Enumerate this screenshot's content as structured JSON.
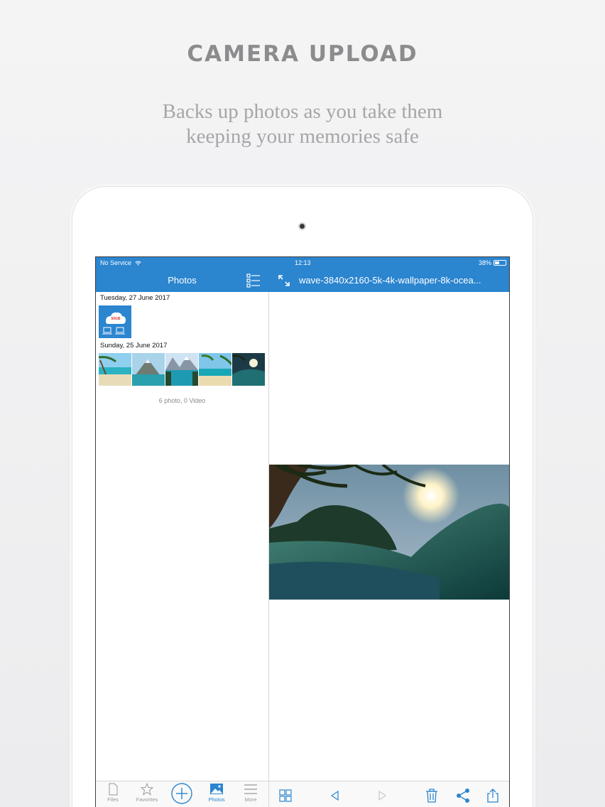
{
  "promo": {
    "headline": "CAMERA UPLOAD",
    "subline_1": "Backs up photos as you take them",
    "subline_2": "keeping your memories safe"
  },
  "status_bar": {
    "carrier": "No Service",
    "time": "12:13",
    "battery": "38%"
  },
  "left_nav": {
    "title": "Photos"
  },
  "right_nav": {
    "filename": "wave-3840x2160-5k-4k-wallpaper-8k-ocea..."
  },
  "photos": {
    "groups": [
      {
        "date": "Tuesday, 27 June 2017",
        "thumb_text": "50GB"
      },
      {
        "date": "Sunday, 25 June 2017"
      }
    ],
    "count": "6 photo, 0 Video"
  },
  "tabs": [
    {
      "label": "Files",
      "icon": "file-icon"
    },
    {
      "label": "Favorites",
      "icon": "star-icon"
    },
    {
      "label": "",
      "icon": "plus-circle-icon"
    },
    {
      "label": "Photos",
      "icon": "image-icon",
      "active": true
    },
    {
      "label": "More",
      "icon": "menu-icon"
    }
  ],
  "colors": {
    "accent": "#2b85cf",
    "headline": "#8c8c8e"
  }
}
